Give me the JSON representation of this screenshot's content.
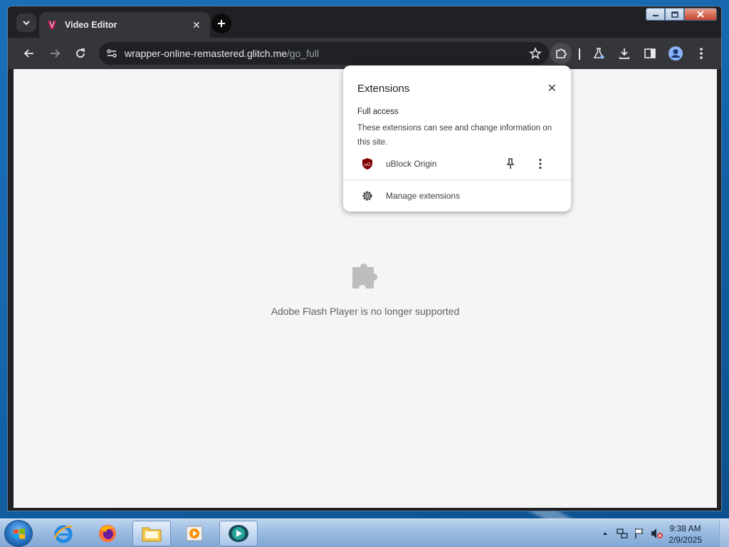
{
  "browser": {
    "tab": {
      "title": "Video Editor"
    },
    "omnibox": {
      "host": "wrapper-online-remastered.glitch.me",
      "path": "/go_full"
    }
  },
  "content": {
    "plugin_message": "Adobe Flash Player is no longer supported"
  },
  "extensions_popup": {
    "title": "Extensions",
    "section_title": "Full access",
    "section_description": "These extensions can see and change information on this site.",
    "extensions": [
      {
        "name": "uBlock Origin"
      }
    ],
    "manage_label": "Manage extensions"
  },
  "taskbar": {
    "apps": [
      "internet-explorer",
      "firefox",
      "file-explorer",
      "media-player",
      "screen-recorder"
    ],
    "clock": {
      "time": "9:38 AM",
      "date": "2/9/2025"
    }
  },
  "colors": {
    "chrome_frame": "#202124",
    "toolbar": "#35363a",
    "page_background": "#f5f5f5",
    "ublock_red": "#800000"
  }
}
